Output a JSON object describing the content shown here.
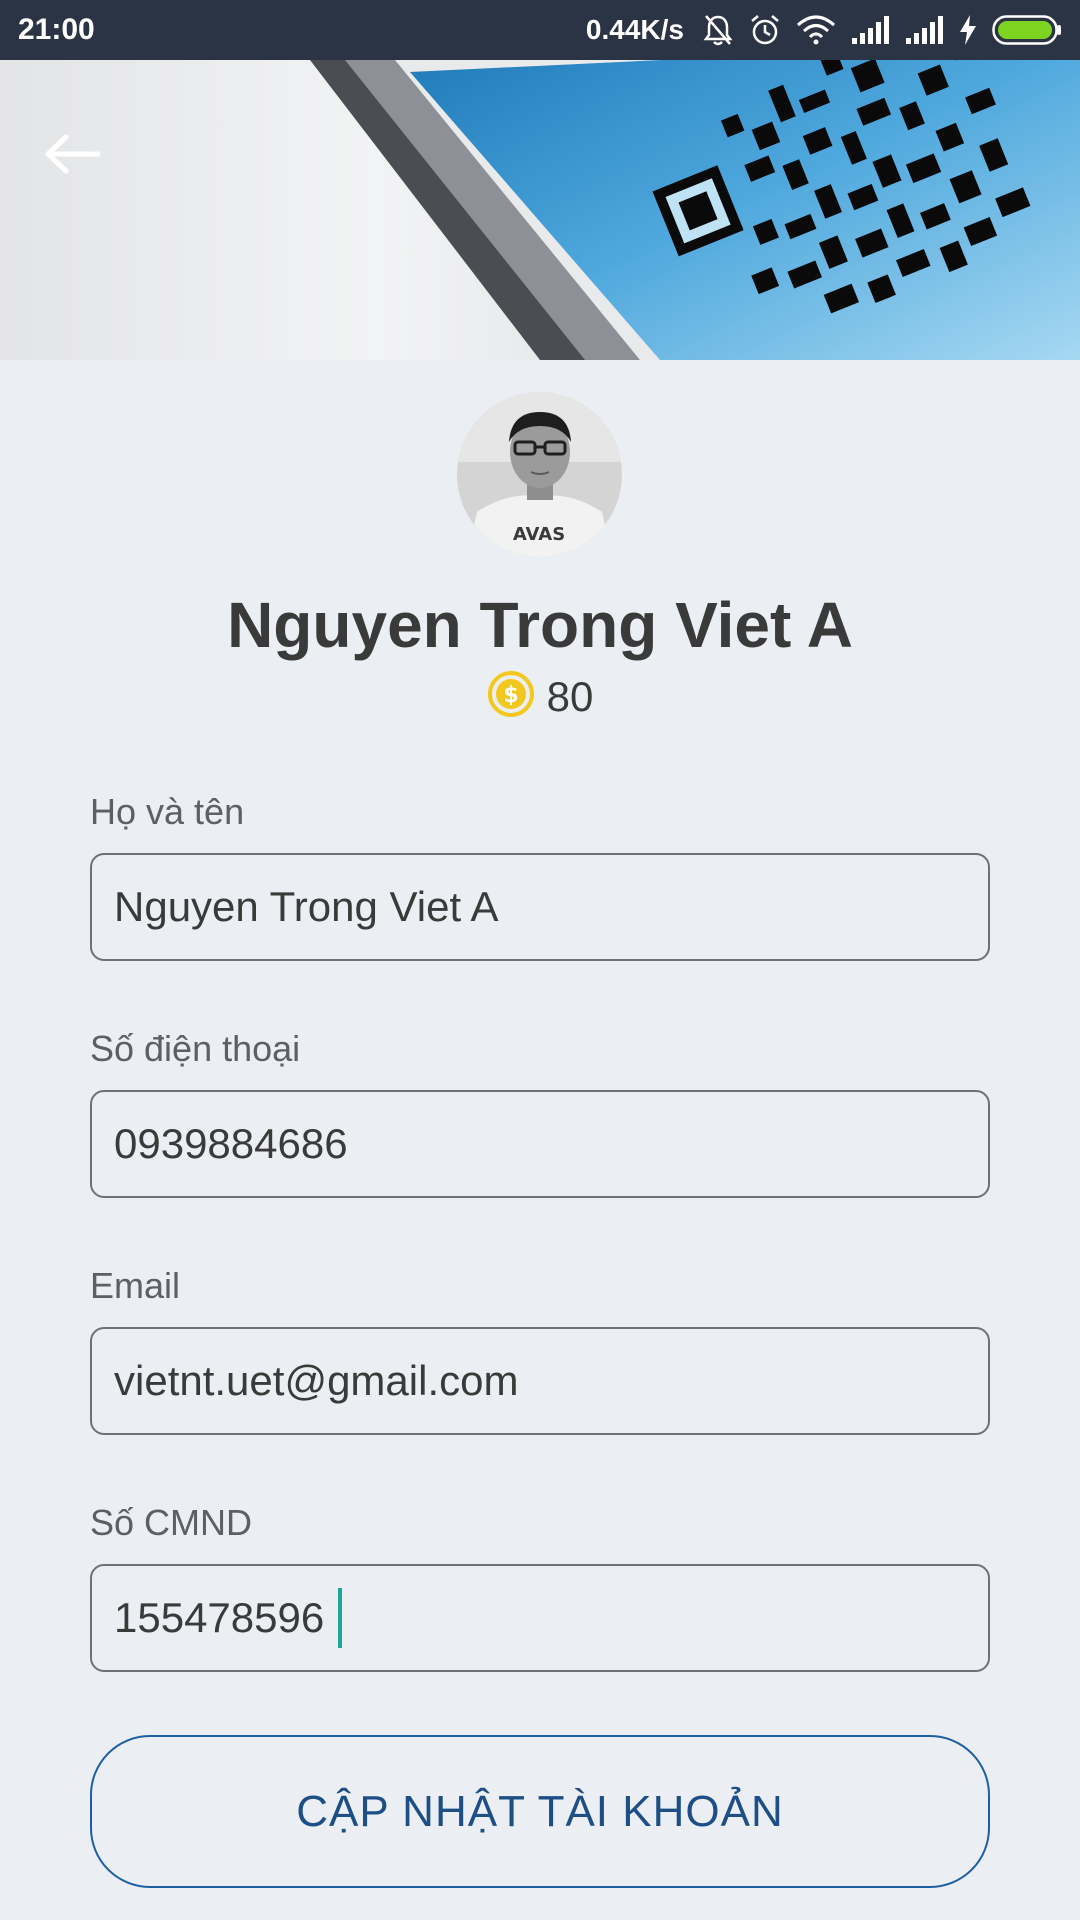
{
  "status_bar": {
    "time": "21:00",
    "network_speed": "0.44K/s",
    "icons": [
      "mute-bell-icon",
      "alarm-icon",
      "wifi-icon",
      "signal-icon",
      "signal-icon",
      "charging-icon",
      "battery-icon"
    ],
    "battery_color": "#7ED321"
  },
  "header": {
    "back_icon": "arrow-left-icon",
    "banner_image": "qr-code-phone-banner"
  },
  "profile": {
    "name": "Nguyen Trong Viet A",
    "coin_icon": "dollar-coin-icon",
    "coins": "80"
  },
  "form": {
    "full_name": {
      "label": "Họ và tên",
      "value": "Nguyen Trong Viet A"
    },
    "phone": {
      "label": "Số điện thoại",
      "value": "0939884686"
    },
    "email": {
      "label": "Email",
      "value": "vietnt.uet@gmail.com"
    },
    "id_number": {
      "label": "Số CMND",
      "value": "155478596"
    }
  },
  "actions": {
    "update_label": "CẬP NHẬT TÀI KHOẢN"
  },
  "colors": {
    "status_bar_bg": "#2B3444",
    "page_bg": "#EBEEF3",
    "button_border": "#1D5FA3",
    "button_text": "#1D4F86",
    "coin": "#F2C81F",
    "caret": "#1EA69A"
  }
}
